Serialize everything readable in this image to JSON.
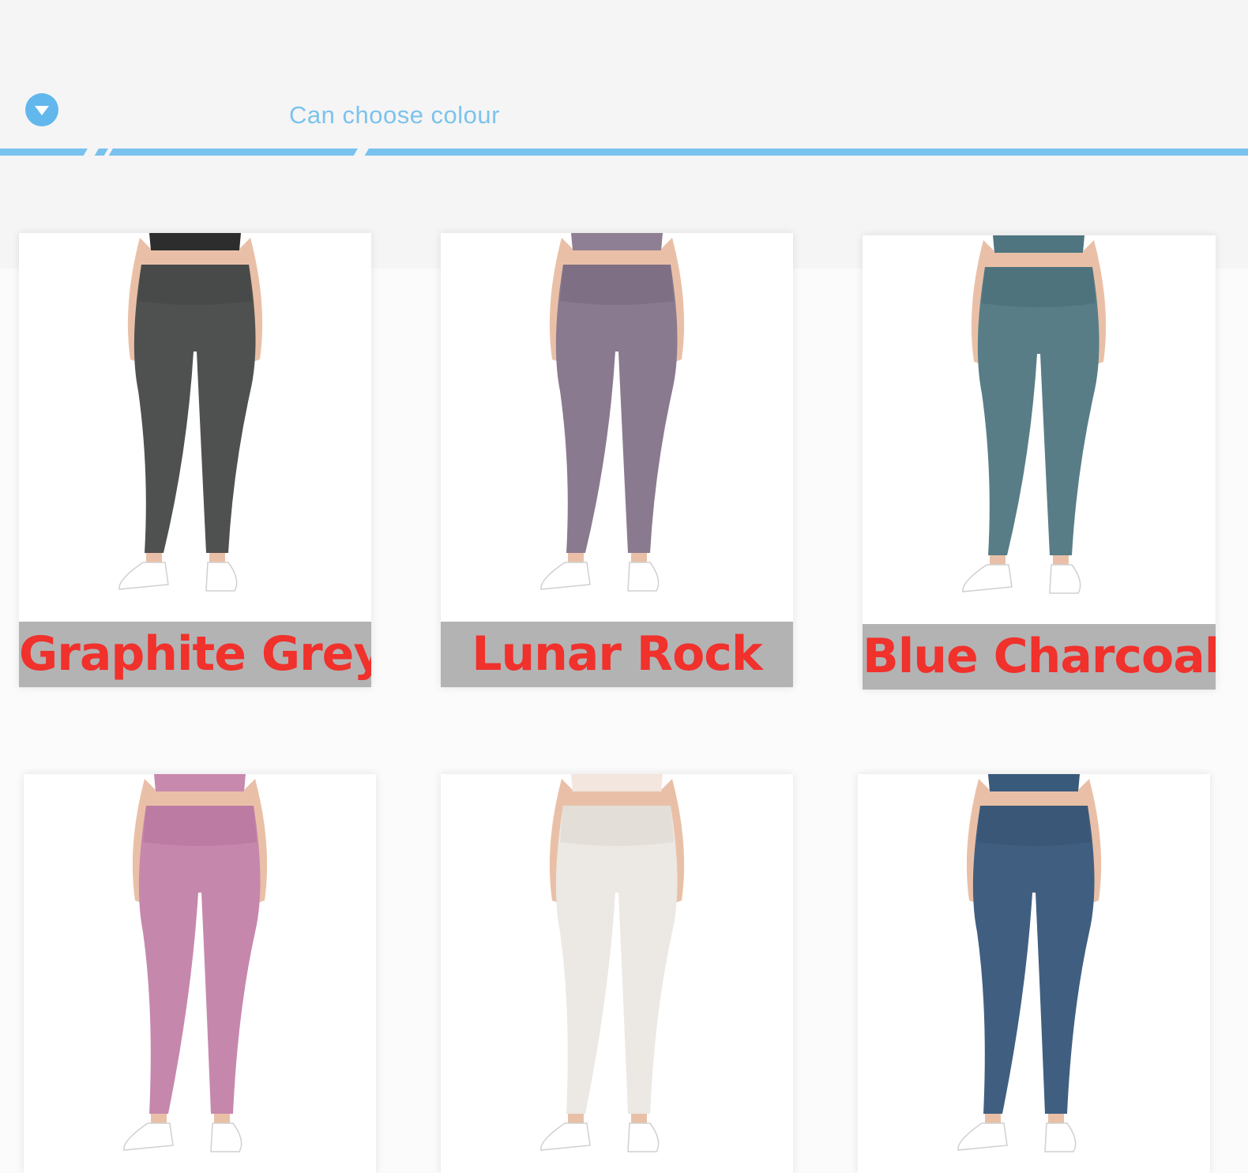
{
  "header": {
    "title": "Can choose colour",
    "icon": "chevron-down-circle-icon",
    "accent_color": "#79c2ee"
  },
  "products": [
    {
      "label": "Graphite Grey",
      "color": "#4f5150",
      "band": "#484a49",
      "top_color": "#2d2d2d",
      "text_color": "#f0312c"
    },
    {
      "label": "Lunar Rock",
      "color": "#8a7a8f",
      "band": "#7f6f84",
      "top_color": "#8f7f94",
      "text_color": "#f0312c"
    },
    {
      "label": "Blue Charcoal",
      "color": "#587d87",
      "band": "#4f737d",
      "top_color": "#4f7580",
      "text_color": "#f0312c"
    },
    {
      "label": "",
      "color": "#c687ad",
      "band": "#bb7ba2",
      "top_color": "#c78aae",
      "text_color": "#f0312c"
    },
    {
      "label": "",
      "color": "#ece8e3",
      "band": "#e3ded8",
      "top_color": "#f2e6de",
      "text_color": "#f0312c"
    },
    {
      "label": "",
      "color": "#405f80",
      "band": "#3a5777",
      "top_color": "#3a5a7c",
      "text_color": "#f0312c"
    }
  ]
}
